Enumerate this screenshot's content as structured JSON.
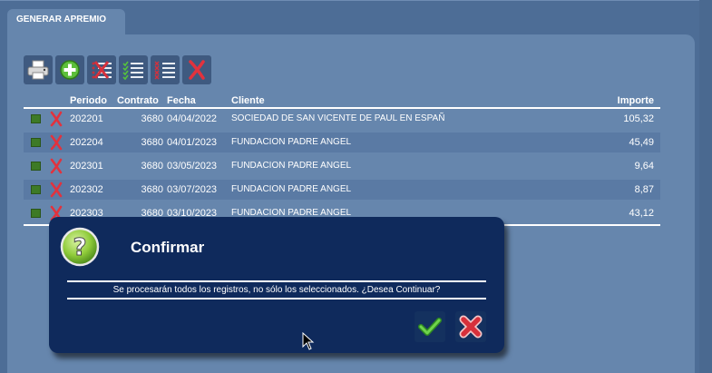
{
  "tab": {
    "label": "GENERAR APREMIO"
  },
  "toolbar": {
    "buttons": [
      {
        "icon": "printer-icon"
      },
      {
        "icon": "add-icon"
      },
      {
        "icon": "uncheck-list-icon"
      },
      {
        "icon": "check-all-icon"
      },
      {
        "icon": "list-icon"
      },
      {
        "icon": "delete-icon"
      }
    ]
  },
  "grid": {
    "headers": {
      "periodo": "Periodo",
      "contrato": "Contrato",
      "fecha": "Fecha",
      "cliente": "Cliente",
      "importe": "Importe"
    },
    "rows": [
      {
        "periodo": "202201",
        "contrato": "3680",
        "fecha": "04/04/2022",
        "cliente": "SOCIEDAD DE SAN VICENTE DE PAUL EN ESPAÑ",
        "importe": "105,32"
      },
      {
        "periodo": "202204",
        "contrato": "3680",
        "fecha": "04/01/2023",
        "cliente": "FUNDACION PADRE ANGEL",
        "importe": "45,49"
      },
      {
        "periodo": "202301",
        "contrato": "3680",
        "fecha": "03/05/2023",
        "cliente": "FUNDACION PADRE ANGEL",
        "importe": "9,64"
      },
      {
        "periodo": "202302",
        "contrato": "3680",
        "fecha": "03/07/2023",
        "cliente": "FUNDACION PADRE ANGEL",
        "importe": "8,87"
      },
      {
        "periodo": "202303",
        "contrato": "3680",
        "fecha": "03/10/2023",
        "cliente": "FUNDACION PADRE ANGEL",
        "importe": "43,12"
      }
    ]
  },
  "dialog": {
    "title": "Confirmar",
    "message": "Se procesarán todos los registros, no sólo los seleccionados. ¿Desea Continuar?",
    "icon": "question-icon",
    "accept_icon": "check-icon",
    "cancel_icon": "cancel-icon"
  },
  "colors": {
    "background": "#4a6a94",
    "panel": "#6686ad",
    "dialog": "#0f2a5c",
    "accept": "#49b33a",
    "cancel": "#d6303b"
  }
}
